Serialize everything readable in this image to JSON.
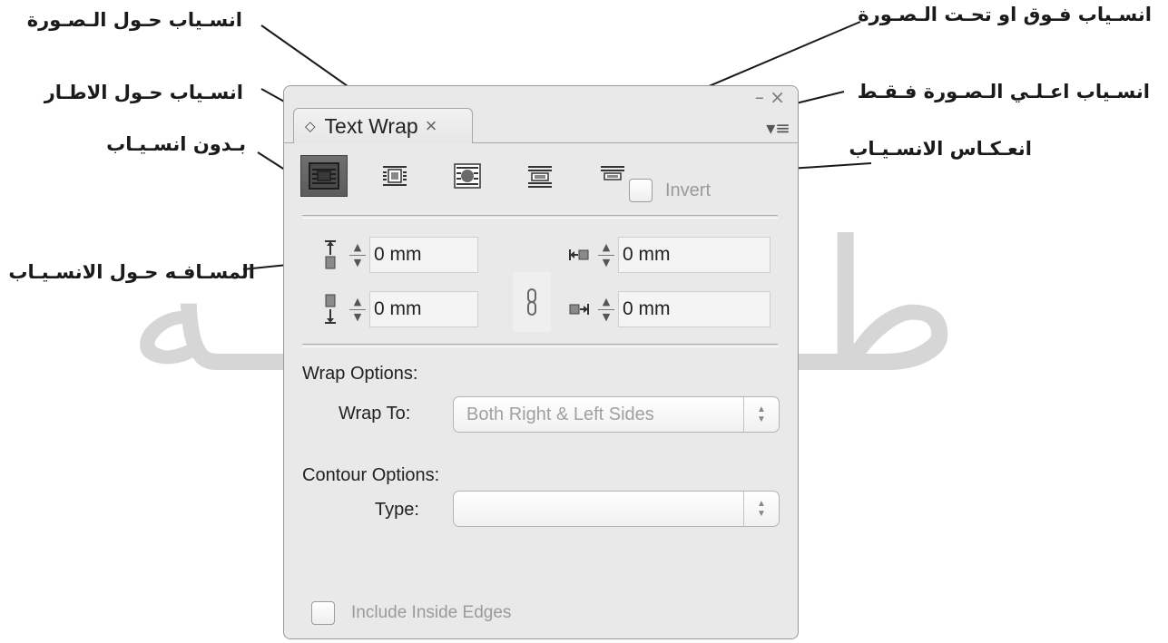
{
  "watermark": {
    "left_glyph": "لـه",
    "right_glyph": "طـ"
  },
  "callouts": {
    "wrap_around_image": "انسـياب حـول الـصـورة",
    "wrap_above_below": "انسـياب فـوق او تحـت الـصـورة",
    "wrap_around_frame": "انسـياب حـول الاطـار",
    "wrap_above_only": "انسـياب اعـلـي الـصـورة فـقـط",
    "no_wrap": "بـدون انسـيـاب",
    "invert_wrap": "انعـكـاس الانسـيـاب",
    "offset_distance": "المسـافـه حـول الانسـيـاب"
  },
  "panel": {
    "tab_title": "Text Wrap",
    "tab_close": "×",
    "window_controls": "– ×",
    "menu_icon": "▾≡",
    "invert_label": "Invert",
    "offsets": {
      "top": "0 mm",
      "bottom": "0 mm",
      "left": "0 mm",
      "right": "0 mm"
    },
    "wrap_options_label": "Wrap Options:",
    "wrap_to_label": "Wrap To:",
    "wrap_to_value": "Both Right & Left Sides",
    "contour_options_label": "Contour Options:",
    "type_label": "Type:",
    "type_value": "",
    "include_inside_edges_label": "Include Inside Edges"
  },
  "icons": [
    "no-wrap-icon",
    "wrap-bounding-box-icon",
    "wrap-object-shape-icon",
    "jump-object-icon",
    "jump-next-column-icon",
    "link-chain-icon"
  ],
  "colors": {
    "panel_bg": "#e9e9e9",
    "active_button": "#5b5b5b",
    "watermark": "#d6d6d6"
  }
}
